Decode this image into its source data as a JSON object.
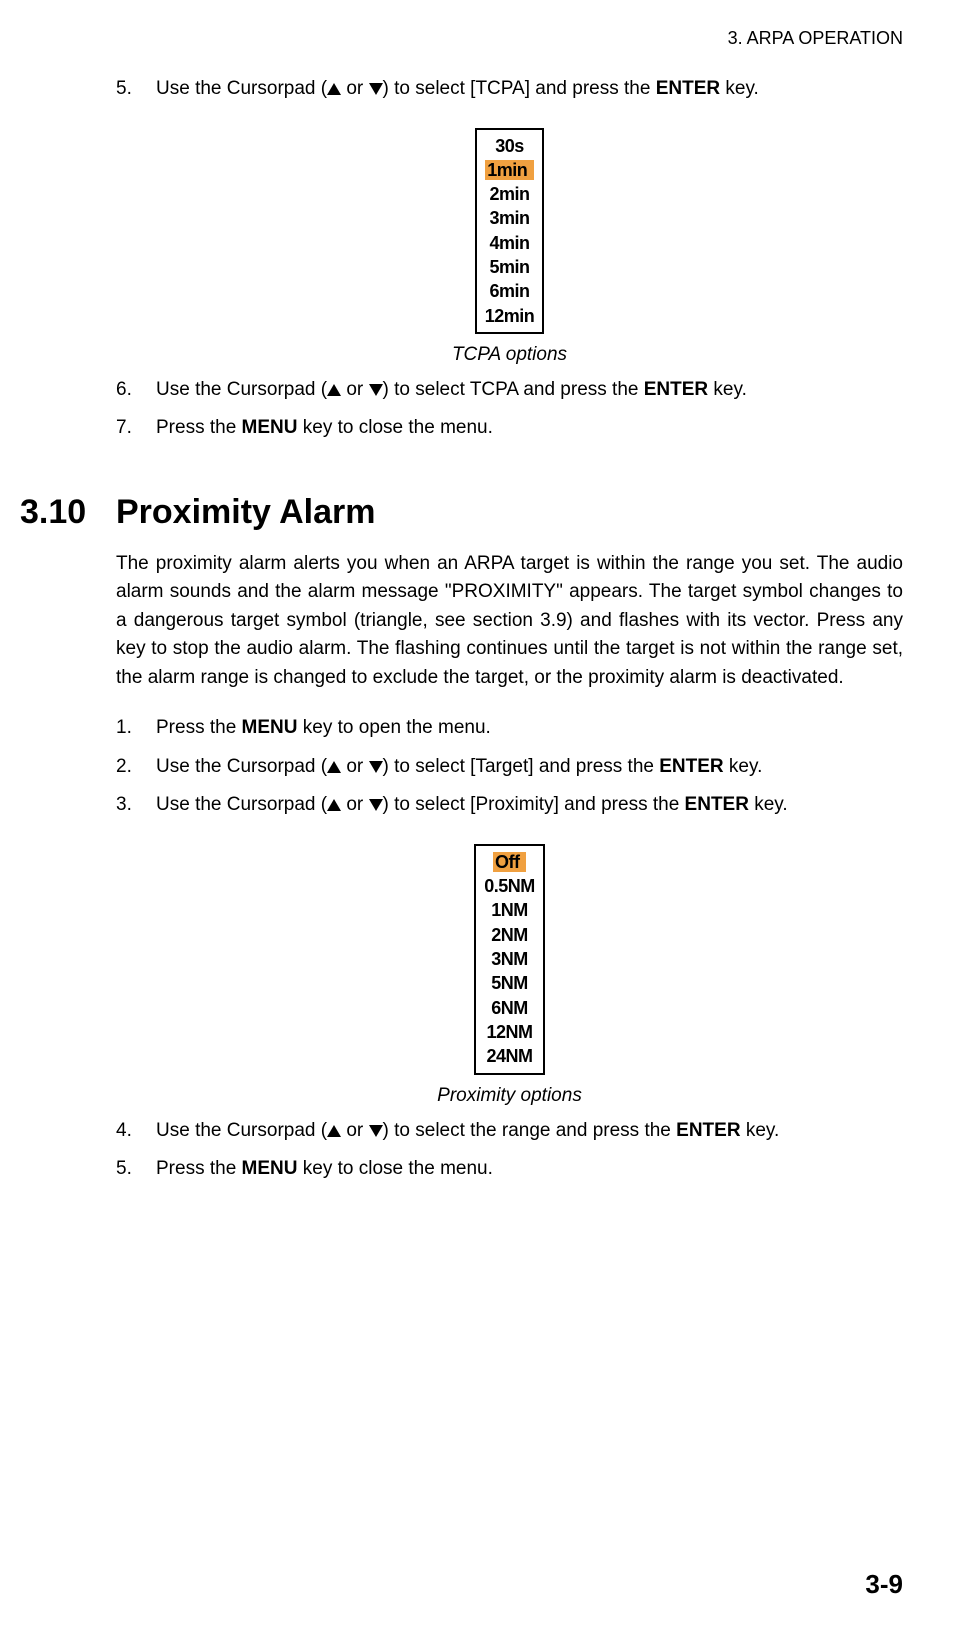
{
  "header": "3.  ARPA OPERATION",
  "preSteps": [
    {
      "num": "5.",
      "before": "Use the Cursorpad (",
      "mid": " or ",
      "after": ") to select [TCPA] and press the ",
      "key": "ENTER",
      "tail": " key."
    }
  ],
  "tcpaOptions": {
    "items": [
      "30s",
      "1min",
      "2min",
      "3min",
      "4min",
      "5min",
      "6min",
      "12min"
    ],
    "highlightIndex": 1,
    "caption": "TCPA options"
  },
  "postTcpaSteps": [
    {
      "num": "6.",
      "before": "Use the Cursorpad (",
      "mid": " or ",
      "after": ") to select TCPA and press the ",
      "key": "ENTER",
      "tail": " key."
    },
    {
      "num": "7.",
      "plain_before": "Press the ",
      "key": "MENU",
      "plain_after": " key to close the menu."
    }
  ],
  "section": {
    "num": "3.10",
    "title": "Proximity Alarm"
  },
  "para": "The proximity alarm alerts you when an ARPA target is within the range you set. The audio alarm sounds and the alarm message \"PROXIMITY\" appears. The target symbol changes to a dangerous target symbol (triangle, see section 3.9) and flashes with its vector. Press any key to stop the audio alarm. The flashing continues until the target is not within the range set, the alarm range is changed to exclude the target, or the proximity alarm is deactivated.",
  "proxSteps1": [
    {
      "num": "1.",
      "plain_before": "Press the ",
      "key": "MENU",
      "plain_after": " key to open the menu."
    },
    {
      "num": "2.",
      "before": "Use the Cursorpad (",
      "mid": " or ",
      "after": ") to select [Target] and press the ",
      "key": "ENTER",
      "tail": " key."
    },
    {
      "num": "3.",
      "before": "Use the Cursorpad (",
      "mid": " or ",
      "after": ") to select [Proximity] and press the ",
      "key": "ENTER",
      "tail": " key."
    }
  ],
  "proxOptions": {
    "items": [
      "Off",
      "0.5NM",
      "1NM",
      "2NM",
      "3NM",
      "5NM",
      "6NM",
      "12NM",
      "24NM"
    ],
    "highlightIndex": 0,
    "caption": "Proximity options"
  },
  "proxSteps2": [
    {
      "num": "4.",
      "before": "Use the Cursorpad (",
      "mid": " or ",
      "after": ") to select the range and press the ",
      "key": "ENTER",
      "tail": " key."
    },
    {
      "num": "5.",
      "plain_before": "Press the ",
      "key": "MENU",
      "plain_after": " key to close the menu."
    }
  ],
  "pageNum": "3-9"
}
